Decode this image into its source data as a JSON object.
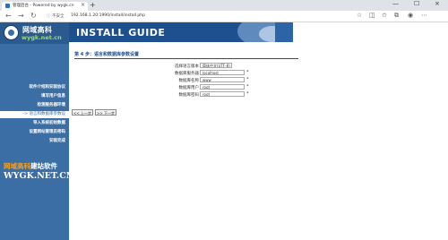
{
  "browser": {
    "tab_title": "管理后台 - Powered by wygk.cn",
    "tab_close": "×",
    "new_tab": "+",
    "minimize": "—",
    "maximize": "☐",
    "close": "×",
    "back": "←",
    "forward": "→",
    "reload": "↻",
    "address_lock": "ⓘ",
    "address_warning": "不安全",
    "address_url": "192.168.1.20:1990/install/install.php"
  },
  "sidebar": {
    "logo_cn": "网域高科",
    "logo_en": "wygk.net.cn",
    "menu": [
      {
        "label": "软件介绍和安装协议",
        "active": false
      },
      {
        "label": "填写用户信息",
        "active": false
      },
      {
        "label": "检测服务器环境",
        "active": false
      },
      {
        "label": "-> 语言和数据库参数设",
        "active": true
      },
      {
        "label": "导入系统初始数据",
        "active": false
      },
      {
        "label": "设置网站管理员密码",
        "active": false
      },
      {
        "label": "安装完成",
        "active": false
      }
    ],
    "brand_cn_colored": "网域高科",
    "brand_cn_plain": "建站软件",
    "brand_en": "WYGK.NET.CN"
  },
  "banner": {
    "title": "INSTALL GUIDE"
  },
  "form": {
    "step_title": "第 4 步：语言和数据库参数设置",
    "rows": [
      {
        "label": "选择语言版本",
        "value": "简体中文(UTF-8)",
        "type": "select",
        "required": false
      },
      {
        "label": "数据库服务器",
        "value": "localhost",
        "type": "text",
        "required": true
      },
      {
        "label": "数据库名称",
        "value": "www",
        "type": "text",
        "required": true
      },
      {
        "label": "数据库用户",
        "value": "root",
        "type": "text",
        "required": true
      },
      {
        "label": "数据库密码",
        "value": "root",
        "type": "text",
        "required": true
      }
    ],
    "required_mark": "*",
    "prev_button": "<< 上一步",
    "next_button": ">> 下一步"
  }
}
